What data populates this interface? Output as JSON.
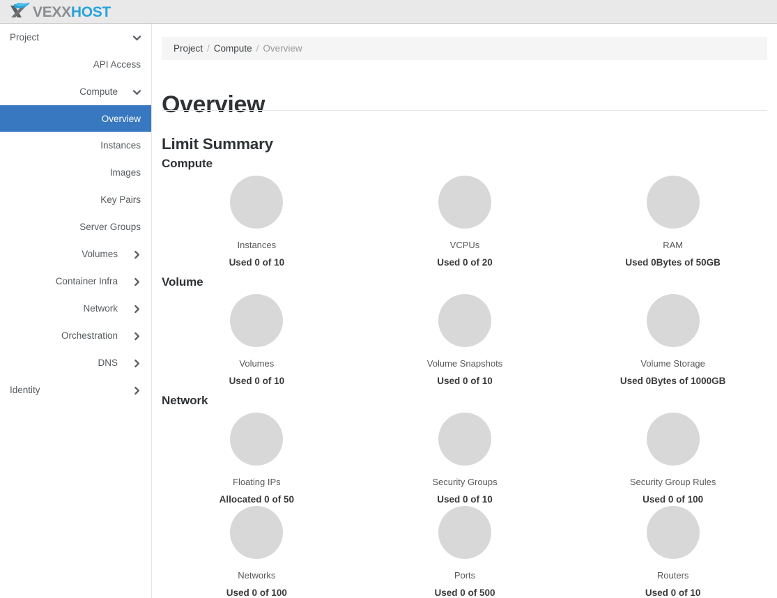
{
  "header": {
    "logo": {
      "text_primary": "VEXX",
      "text_secondary": "HOST",
      "icon": "vexxhost-swoosh-logo"
    },
    "background_color": "#e9e9e9"
  },
  "theme": {
    "accent_color": "#3878c0",
    "donut_empty_color": "#d8d8d8",
    "breadcrumb_bg": "#f5f5f5",
    "text_color": "#2f3336"
  },
  "sidebar": {
    "items": [
      {
        "label": "Project",
        "level": 0,
        "state": "expanded",
        "icon": "chevron-down-icon",
        "active": false
      },
      {
        "label": "API Access",
        "level": 2,
        "state": "leaf",
        "icon": "",
        "active": false
      },
      {
        "label": "Compute",
        "level": 1,
        "state": "expanded",
        "icon": "chevron-down-icon",
        "active": false
      },
      {
        "label": "Overview",
        "level": 2,
        "state": "leaf",
        "icon": "",
        "active": true
      },
      {
        "label": "Instances",
        "level": 2,
        "state": "leaf",
        "icon": "",
        "active": false
      },
      {
        "label": "Images",
        "level": 2,
        "state": "leaf",
        "icon": "",
        "active": false
      },
      {
        "label": "Key Pairs",
        "level": 2,
        "state": "leaf",
        "icon": "",
        "active": false
      },
      {
        "label": "Server Groups",
        "level": 2,
        "state": "leaf",
        "icon": "",
        "active": false
      },
      {
        "label": "Volumes",
        "level": 1,
        "state": "collapsed",
        "icon": "chevron-right-icon",
        "active": false
      },
      {
        "label": "Container Infra",
        "level": 1,
        "state": "collapsed",
        "icon": "chevron-right-icon",
        "active": false
      },
      {
        "label": "Network",
        "level": 1,
        "state": "collapsed",
        "icon": "chevron-right-icon",
        "active": false
      },
      {
        "label": "Orchestration",
        "level": 1,
        "state": "collapsed",
        "icon": "chevron-right-icon",
        "active": false
      },
      {
        "label": "DNS",
        "level": 1,
        "state": "collapsed",
        "icon": "chevron-right-icon",
        "active": false
      },
      {
        "label": "Identity",
        "level": 0,
        "state": "collapsed",
        "icon": "chevron-right-icon",
        "active": false
      }
    ]
  },
  "breadcrumb": {
    "items": [
      {
        "label": "Project",
        "current": false
      },
      {
        "label": "Compute",
        "current": false
      },
      {
        "label": "Overview",
        "current": true
      }
    ],
    "separator": "/"
  },
  "main": {
    "page_title": "Overview",
    "limit_summary_heading": "Limit Summary",
    "sections": [
      {
        "heading": "Compute",
        "rows": [
          [
            {
              "label": "Instances",
              "usage": "Used 0 of 10",
              "used": 0,
              "limit": 10,
              "unit": "count",
              "verb": "Used",
              "percent": 0
            },
            {
              "label": "VCPUs",
              "usage": "Used 0 of 20",
              "used": 0,
              "limit": 20,
              "unit": "count",
              "verb": "Used",
              "percent": 0
            },
            {
              "label": "RAM",
              "usage": "Used 0Bytes of 50GB",
              "used": 0,
              "limit": 50,
              "unit": "GB",
              "verb": "Used",
              "percent": 0
            }
          ]
        ]
      },
      {
        "heading": "Volume",
        "rows": [
          [
            {
              "label": "Volumes",
              "usage": "Used 0 of 10",
              "used": 0,
              "limit": 10,
              "unit": "count",
              "verb": "Used",
              "percent": 0
            },
            {
              "label": "Volume Snapshots",
              "usage": "Used 0 of 10",
              "used": 0,
              "limit": 10,
              "unit": "count",
              "verb": "Used",
              "percent": 0
            },
            {
              "label": "Volume Storage",
              "usage": "Used 0Bytes of 1000GB",
              "used": 0,
              "limit": 1000,
              "unit": "GB",
              "verb": "Used",
              "percent": 0
            }
          ]
        ]
      },
      {
        "heading": "Network",
        "rows": [
          [
            {
              "label": "Floating IPs",
              "usage": "Allocated 0 of 50",
              "used": 0,
              "limit": 50,
              "unit": "count",
              "verb": "Allocated",
              "percent": 0
            },
            {
              "label": "Security Groups",
              "usage": "Used 0 of 10",
              "used": 0,
              "limit": 10,
              "unit": "count",
              "verb": "Used",
              "percent": 0
            },
            {
              "label": "Security Group Rules",
              "usage": "Used 0 of 100",
              "used": 0,
              "limit": 100,
              "unit": "count",
              "verb": "Used",
              "percent": 0
            }
          ],
          [
            {
              "label": "Networks",
              "usage": "Used 0 of 100",
              "used": 0,
              "limit": 100,
              "unit": "count",
              "verb": "Used",
              "percent": 0
            },
            {
              "label": "Ports",
              "usage": "Used 0 of 500",
              "used": 0,
              "limit": 500,
              "unit": "count",
              "verb": "Used",
              "percent": 0
            },
            {
              "label": "Routers",
              "usage": "Used 0 of 10",
              "used": 0,
              "limit": 10,
              "unit": "count",
              "verb": "Used",
              "percent": 0
            }
          ]
        ]
      }
    ]
  }
}
